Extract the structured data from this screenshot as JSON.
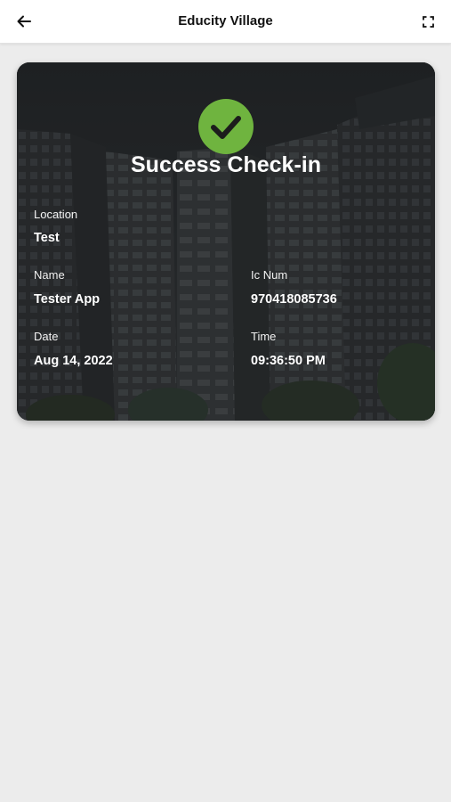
{
  "header": {
    "title": "Educity Village",
    "back_icon": "arrow-left-icon",
    "expand_icon": "fullscreen-icon"
  },
  "card": {
    "status_icon": "check-circle-icon",
    "status_color": "#6fb43f",
    "title": "Success Check-in",
    "location_label": "Location",
    "location_value": "Test",
    "name_label": "Name",
    "name_value": "Tester App",
    "ic_label": "Ic Num",
    "ic_value": "970418085736",
    "date_label": "Date",
    "date_value": "Aug 14, 2022",
    "time_label": "Time",
    "time_value": "09:36:50 PM"
  }
}
